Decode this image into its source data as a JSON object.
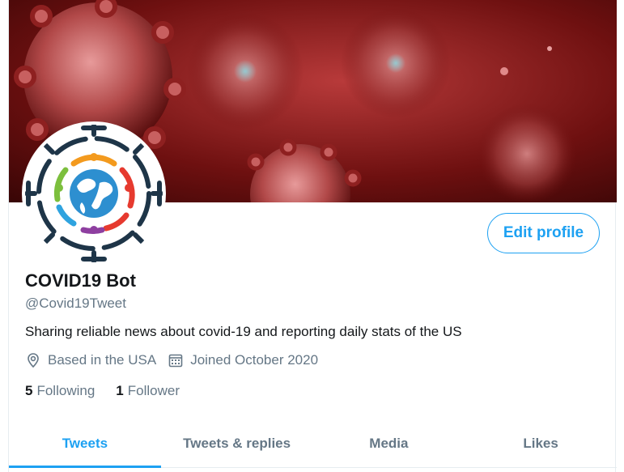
{
  "profile": {
    "name": "COVID19 Bot",
    "handle": "@Covid19Tweet",
    "bio": "Sharing reliable news about covid-19 and reporting daily stats of the US",
    "location": "Based in the USA",
    "joined": "Joined October 2020",
    "following_count": "5",
    "following_label": "Following",
    "followers_count": "1",
    "followers_label": "Follower"
  },
  "actions": {
    "edit_profile_label": "Edit profile"
  },
  "tabs": [
    {
      "label": "Tweets",
      "active": true
    },
    {
      "label": "Tweets & replies",
      "active": false
    },
    {
      "label": "Media",
      "active": false
    },
    {
      "label": "Likes",
      "active": false
    }
  ],
  "icons": {
    "location": "location-pin-icon",
    "calendar": "calendar-icon"
  },
  "colors": {
    "accent": "#1da1f2",
    "secondary_text": "#657786",
    "primary_text": "#14171a"
  }
}
